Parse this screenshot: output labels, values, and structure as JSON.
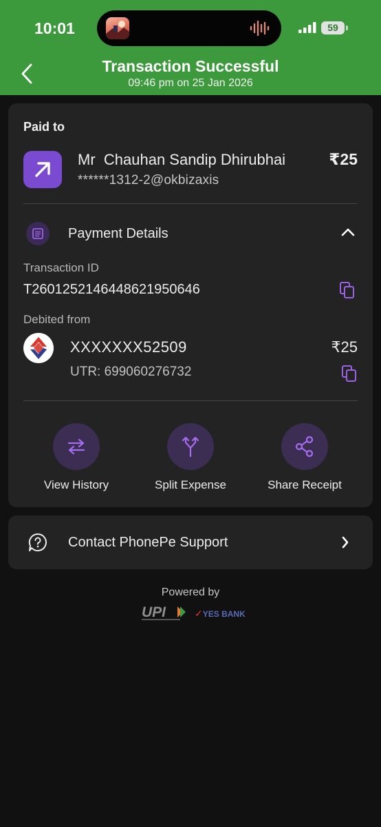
{
  "status_bar": {
    "time": "10:01",
    "battery": "59"
  },
  "header": {
    "title": "Transaction Successful",
    "subtitle": "09:46 pm on 25 Jan 2026"
  },
  "paid_to": {
    "heading": "Paid to",
    "name": "Mr  Chauhan Sandip Dhirubhai",
    "upi_id": "******1312-2@okbizaxis",
    "amount": "₹25"
  },
  "payment_details": {
    "heading": "Payment Details",
    "transaction_id_label": "Transaction ID",
    "transaction_id": "T2601252146448621950646",
    "debited_from_label": "Debited from",
    "account": "XXXXXXX52509",
    "utr": "UTR: 699060276732",
    "amount": "₹25"
  },
  "actions": [
    {
      "label": "View History",
      "icon": "arrows-swap-icon"
    },
    {
      "label": "Split Expense",
      "icon": "split-icon"
    },
    {
      "label": "Share Receipt",
      "icon": "share-icon"
    }
  ],
  "support": {
    "label": "Contact PhonePe Support"
  },
  "footer": {
    "powered_by": "Powered by",
    "upi_logo": "UPI",
    "bank_logo": "YES BANK"
  },
  "colors": {
    "header_green": "#3c9a3c",
    "accent_purple": "#9b62e6",
    "card_bg": "#232323"
  }
}
